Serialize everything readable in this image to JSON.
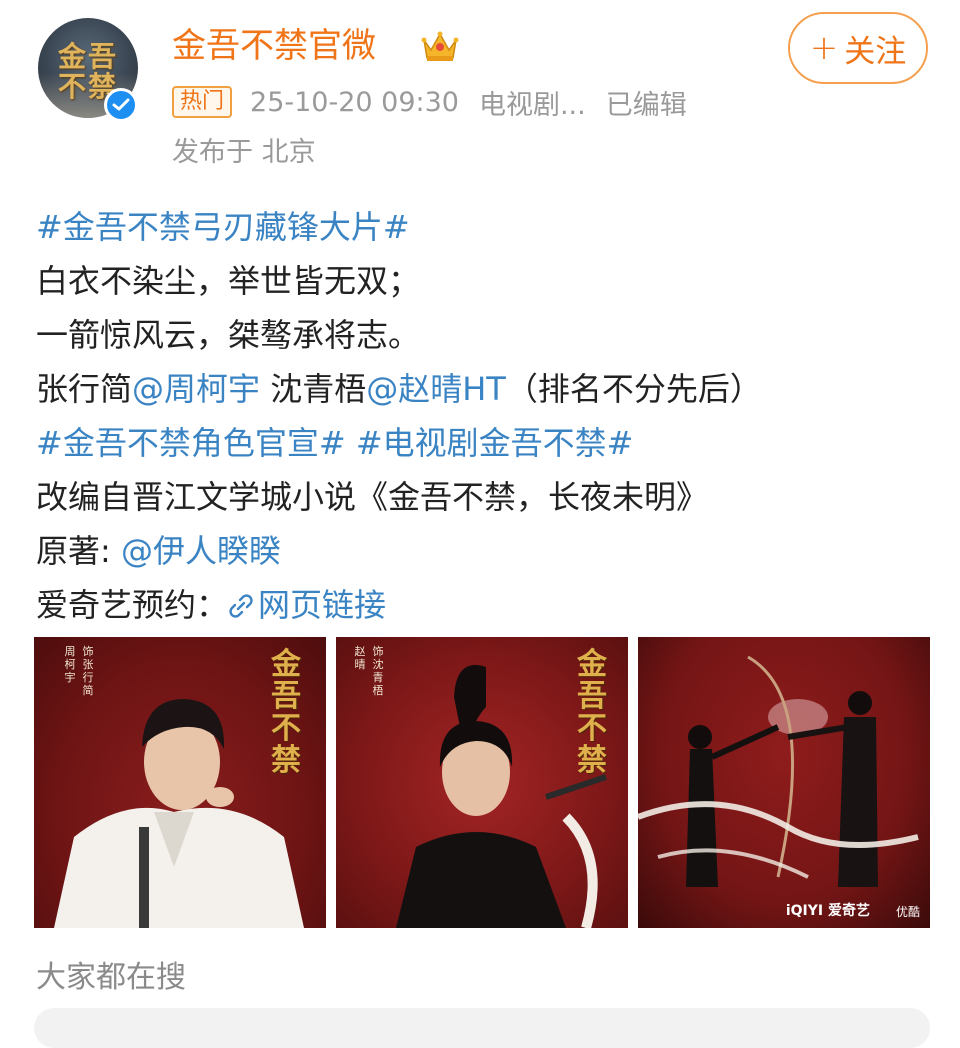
{
  "post": {
    "author": {
      "name": "金吾不禁官微",
      "avatar_text": [
        "金吾",
        "不禁"
      ],
      "verified": true
    },
    "follow_label": "关注",
    "meta": {
      "badge": "热门",
      "timestamp": "25-10-20 09:30",
      "source": "电视剧...",
      "edited": "已编辑",
      "location": "发布于 北京"
    },
    "content": {
      "line1": {
        "hashtag": "#金吾不禁弓刃藏锋大片#"
      },
      "line2": "白衣不染尘，举世皆无双；",
      "line3": "一箭惊风云，桀骜承将志。",
      "line4": {
        "part1": "张行简",
        "mention1": "@周柯宇",
        "part2": " 沈青梧",
        "mention2": "@赵晴HT",
        "part3": "（排名不分先后）"
      },
      "line5": {
        "hashtag1": "#金吾不禁角色官宣#",
        "hashtag2": "#电视剧金吾不禁#"
      },
      "line6": "改编自晋江文学城小说《金吾不禁，长夜未明》",
      "line7": {
        "label": "原著: ",
        "mention": "@伊人睽睽"
      },
      "line8": {
        "label": "爱奇艺预约：",
        "link_text": "网页链接"
      }
    },
    "images": [
      {
        "title": "金吾不禁",
        "credit_role": "饰 张行简",
        "credit_actor": "周柯宇"
      },
      {
        "title": "金吾不禁",
        "credit_role": "饰 沈青梧",
        "credit_actor": "赵晴"
      },
      {
        "brand1": "iQIYI 爱奇艺",
        "brand2": "优酷"
      }
    ]
  },
  "search_section": {
    "title": "大家都在搜"
  },
  "colors": {
    "username": "#f07418",
    "link": "#3b84c4",
    "meta": "#9a9a9a",
    "verified": "#1e8ff2"
  }
}
